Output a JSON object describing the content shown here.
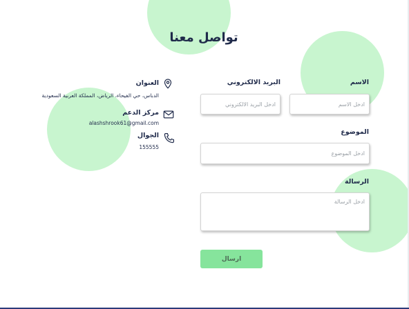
{
  "page": {
    "title": "تواصل معنا"
  },
  "form": {
    "name_label": "الاسم",
    "name_placeholder": "ادخل الاسم",
    "email_label": "البريد الالكتروني",
    "email_placeholder": "ادخل البريد الالكتروني",
    "subject_label": "الموضوع",
    "subject_placeholder": "ادخل الموضوع",
    "message_label": "الرسالة",
    "message_placeholder": "ادخل الرسالة",
    "submit_label": "ارسال"
  },
  "contact": {
    "address_title": "العنوان",
    "address_value": "الدباس، حي الفيحاء، الرياض، المملكة العربية السعودية",
    "support_title": "مركز الدعم",
    "support_value": "alashshrook61@gmail.com",
    "phone_title": "الجوال",
    "phone_value": "155555",
    "icons": [
      "location-pin-icon",
      "mail-icon",
      "phone-icon"
    ]
  },
  "colors": {
    "accent": "#86e49c",
    "decor_circle": "#c8f5cf",
    "text": "#1f2a4a"
  }
}
